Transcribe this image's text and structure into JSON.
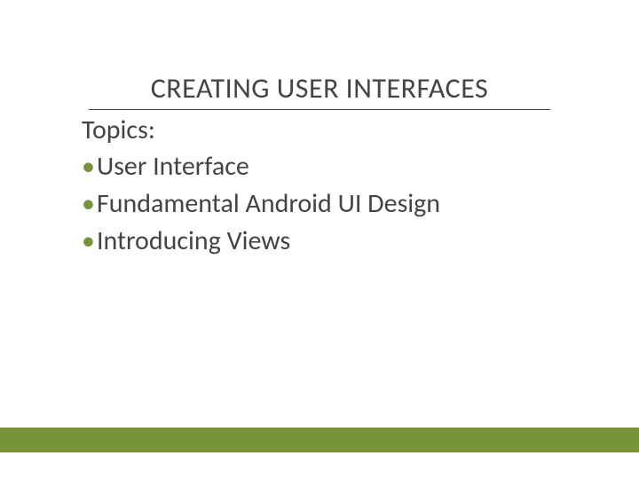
{
  "slide": {
    "title": "CREATING USER INTERFACES",
    "subtitle": "Topics:",
    "bullets": [
      "User Interface",
      "Fundamental Android UI Design",
      "Introducing Views"
    ]
  },
  "colors": {
    "accent": "#77933c",
    "text": "#444444"
  }
}
